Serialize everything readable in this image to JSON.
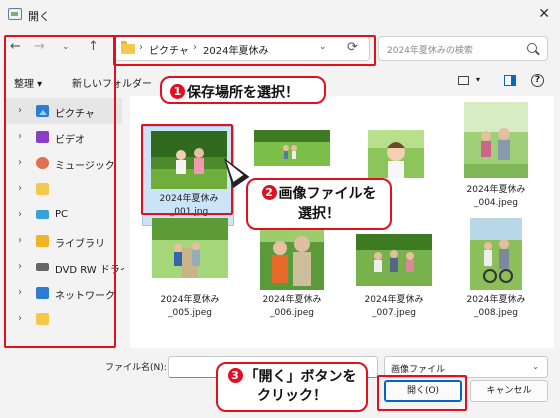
{
  "window": {
    "title": "開く",
    "close_glyph": "✕"
  },
  "nav": {
    "back_glyph": "←",
    "forward_glyph": "→",
    "history_glyph": "⌄",
    "up_glyph": "↑",
    "address": {
      "separator": "›",
      "crumbs": [
        "ピクチャ",
        "2024年夏休み"
      ],
      "dropdown_glyph": "⌄",
      "refresh_glyph": "⟳"
    },
    "search_placeholder": "2024年夏休みの検索"
  },
  "commandbar": {
    "organize_label": "整理 ▾",
    "new_folder_label": "新しいフォルダー",
    "view_dropdown_glyph": "▾",
    "help_glyph": "?"
  },
  "sidebar": {
    "chevron_glyph": "›",
    "items": [
      {
        "label": "ピクチャ",
        "icon": "pictures-icon",
        "active": true
      },
      {
        "label": "ビデオ",
        "icon": "video-icon"
      },
      {
        "label": "ミュージック",
        "icon": "music-icon"
      },
      {
        "label": "",
        "icon": "folder-icon"
      },
      {
        "label": "PC",
        "icon": "pc-icon"
      },
      {
        "label": "ライブラリ",
        "icon": "library-icon"
      },
      {
        "label": "DVD RW ドライブ",
        "icon": "dvd-drive-icon"
      },
      {
        "label": "ネットワーク",
        "icon": "network-icon"
      },
      {
        "label": "",
        "icon": "folder-icon"
      }
    ]
  },
  "files": [
    {
      "line1": "2024年夏休み",
      "line2": "_001.jpg",
      "selected": true
    },
    {
      "line1": "",
      "line2": "",
      "selected": false
    },
    {
      "line1": "",
      "line2": "",
      "selected": false
    },
    {
      "line1": "2024年夏休み",
      "line2": "_004.jpeg",
      "selected": false
    },
    {
      "line1": "2024年夏休み",
      "line2": "_005.jpeg",
      "selected": false
    },
    {
      "line1": "2024年夏休み",
      "line2": "_006.jpeg",
      "selected": false
    },
    {
      "line1": "2024年夏休み",
      "line2": "_007.jpeg",
      "selected": false
    },
    {
      "line1": "2024年夏休み",
      "line2": "_008.jpeg",
      "selected": false
    }
  ],
  "footer": {
    "filename_label": "ファイル名(N):",
    "filename_value": "",
    "filetype_value": "画像ファイル",
    "filetype_chevron": "⌄",
    "open_label": "開く(O)",
    "cancel_label": "キャンセル"
  },
  "callouts": {
    "step1_num": "1",
    "step1_text": "保存場所を選択！",
    "step2_num": "2",
    "step2_line1": "画像ファイルを",
    "step2_line2": "選択！",
    "step3_num": "3",
    "step3_line1": "「開く」ボタンを",
    "step3_line2": "クリック！"
  },
  "colors": {
    "annotation_red": "#e0101f",
    "accent_blue": "#0067c0",
    "selection": "#cce4f7"
  }
}
